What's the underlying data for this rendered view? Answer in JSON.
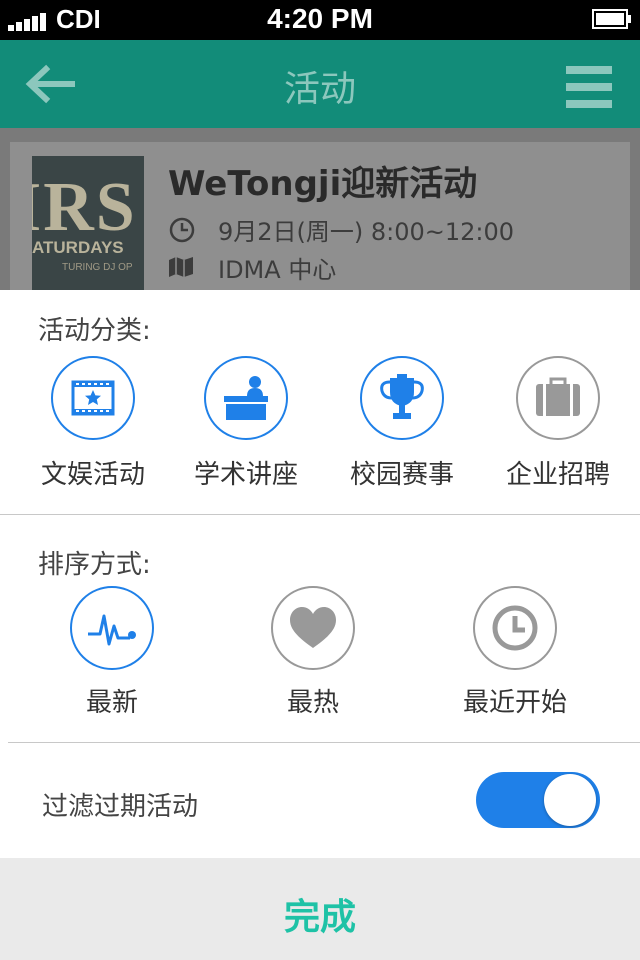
{
  "status_bar": {
    "carrier": "CDI",
    "time": "4:20 PM"
  },
  "nav": {
    "title": "活动",
    "back_icon": "arrow-left-icon",
    "menu_icon": "hamburger-menu-icon"
  },
  "event": {
    "title": "WeTongji迎新活动",
    "time": "9月2日(周一) 8:00~12:00",
    "place": "IDMA 中心",
    "thumb_text_big": "IRS",
    "thumb_text_small": "ATURDAYS",
    "thumb_text_tiny": "TURING DJ OP"
  },
  "category": {
    "label": "活动分类:",
    "items": [
      {
        "label": "文娱活动",
        "icon": "film-star-icon",
        "active": true
      },
      {
        "label": "学术讲座",
        "icon": "lecture-podium-icon",
        "active": true
      },
      {
        "label": "校园赛事",
        "icon": "trophy-icon",
        "active": true
      },
      {
        "label": "企业招聘",
        "icon": "briefcase-icon",
        "active": false
      }
    ]
  },
  "sort": {
    "label": "排序方式:",
    "items": [
      {
        "label": "最新",
        "icon": "pulse-icon",
        "active": true
      },
      {
        "label": "最热",
        "icon": "heart-icon",
        "active": false
      },
      {
        "label": "最近开始",
        "icon": "clock-icon",
        "active": false
      }
    ]
  },
  "filter": {
    "label": "过滤过期活动",
    "enabled": true
  },
  "done": {
    "label": "完成"
  },
  "colors": {
    "nav_bg": "#128c79",
    "accent_blue": "#1f80e8",
    "done_text": "#1ec2a6",
    "inactive_gray": "#999999"
  }
}
